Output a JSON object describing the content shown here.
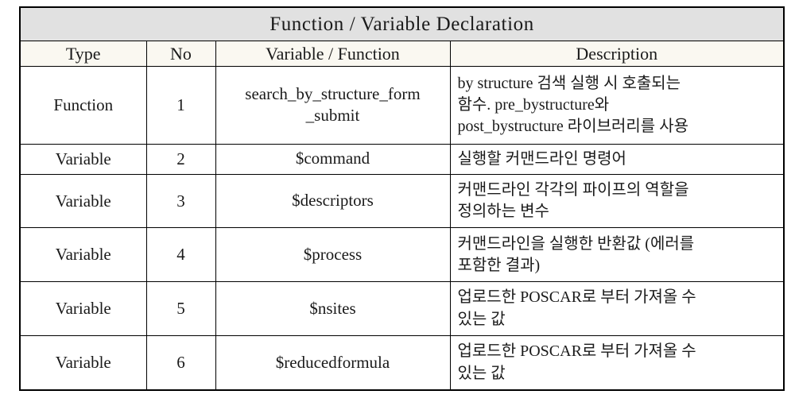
{
  "table": {
    "title": "Function / Variable Declaration",
    "columns": [
      {
        "key": "type",
        "label": "Type"
      },
      {
        "key": "no",
        "label": "No"
      },
      {
        "key": "variable",
        "label": "Variable / Function"
      },
      {
        "key": "description",
        "label": "Description"
      }
    ],
    "rows": [
      {
        "type": "Function",
        "no": "1",
        "variable_lines": [
          "search_by_structure_form",
          "_submit"
        ],
        "variable": "search_by_structure_form_submit",
        "description_lines": [
          "by structure 검색 실행 시 호출되는",
          "함수. pre_bystructure와",
          "post_bystructure 라이브러리를 사용"
        ],
        "description": "by structure 검색 실행 시 호출되는 함수. pre_bystructure와 post_bystructure 라이브러리를 사용",
        "justify": false
      },
      {
        "type": "Variable",
        "no": "2",
        "variable_lines": [
          "$command"
        ],
        "variable": "$command",
        "description_lines": [
          "실행할 커맨드라인 명령어"
        ],
        "description": "실행할 커맨드라인 명령어",
        "justify": false
      },
      {
        "type": "Variable",
        "no": "3",
        "variable_lines": [
          "$descriptors"
        ],
        "variable": "$descriptors",
        "description_lines": [
          "커맨드라인 각각의 파이프의   역할을",
          "정의하는 변수"
        ],
        "description": "커맨드라인 각각의 파이프의 역할을 정의하는 변수",
        "justify": true
      },
      {
        "type": "Variable",
        "no": "4",
        "variable_lines": [
          "$process"
        ],
        "variable": "$process",
        "description_lines": [
          "커맨드라인을 실행한 반환값 (에러를",
          "포함한 결과)"
        ],
        "description": "커맨드라인을 실행한 반환값 (에러를 포함한 결과)",
        "justify": false
      },
      {
        "type": "Variable",
        "no": "5",
        "variable_lines": [
          "$nsites"
        ],
        "variable": "$nsites",
        "description_lines": [
          "업로드한 POSCAR로 부터 가져올 수",
          "있는 값"
        ],
        "description": "업로드한 POSCAR로 부터 가져올 수 있는 값",
        "justify": false
      },
      {
        "type": "Variable",
        "no": "6",
        "variable_lines": [
          "$reducedformula"
        ],
        "variable": "$reducedformula",
        "description_lines": [
          "업로드한 POSCAR로 부터 가져올 수",
          "있는 값"
        ],
        "description": "업로드한 POSCAR로 부터 가져올 수 있는 값",
        "justify": false
      }
    ]
  },
  "colors": {
    "title_background": "#E1E1E1",
    "header_background": "#FAF8F1",
    "cell_background": "#FFFFFF",
    "border": "#000000",
    "text": "#1A1A1A"
  }
}
